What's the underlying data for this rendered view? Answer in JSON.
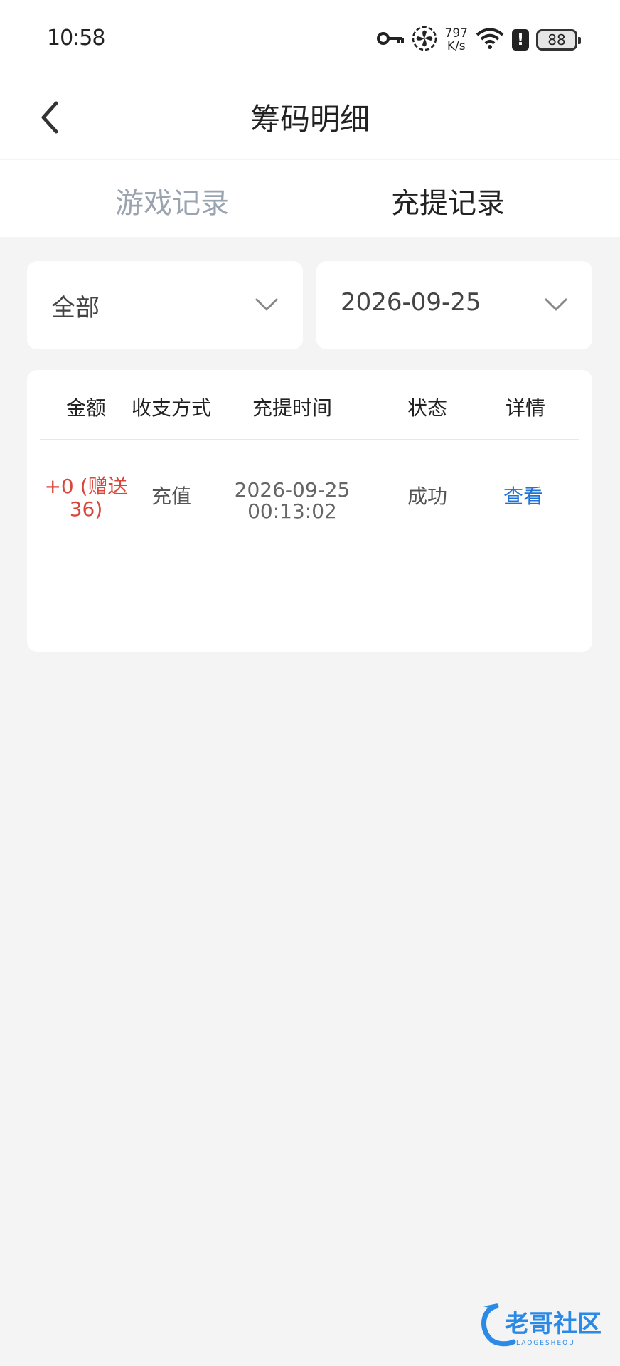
{
  "status_bar": {
    "time": "10:58",
    "net_speed_value": "797",
    "net_speed_unit": "K/s",
    "battery": "88",
    "icons": [
      "key-icon",
      "fan-icon",
      "wifi-icon",
      "alert-icon",
      "battery-icon"
    ]
  },
  "header": {
    "title": "筹码明细"
  },
  "tabs": [
    {
      "label": "游戏记录",
      "active": false
    },
    {
      "label": "充提记录",
      "active": true
    }
  ],
  "filters": {
    "type_selected": "全部",
    "date_selected": "2026-09-25"
  },
  "table": {
    "columns": [
      "金额",
      "收支方式",
      "充提时间",
      "状态",
      "详情"
    ],
    "rows": [
      {
        "amount_line1": "+0 (赠送",
        "amount_line2": "36)",
        "method": "充值",
        "date": "2026-09-25",
        "time": "00:13:02",
        "status": "成功",
        "detail": "查看"
      }
    ]
  },
  "watermark": {
    "text": "老哥社区",
    "subtext": "LAOGESHEQU"
  },
  "colors": {
    "amount": "#d9473b",
    "link": "#1f73d4",
    "tab_inactive": "#9aa3b0",
    "background": "#f4f4f5"
  }
}
